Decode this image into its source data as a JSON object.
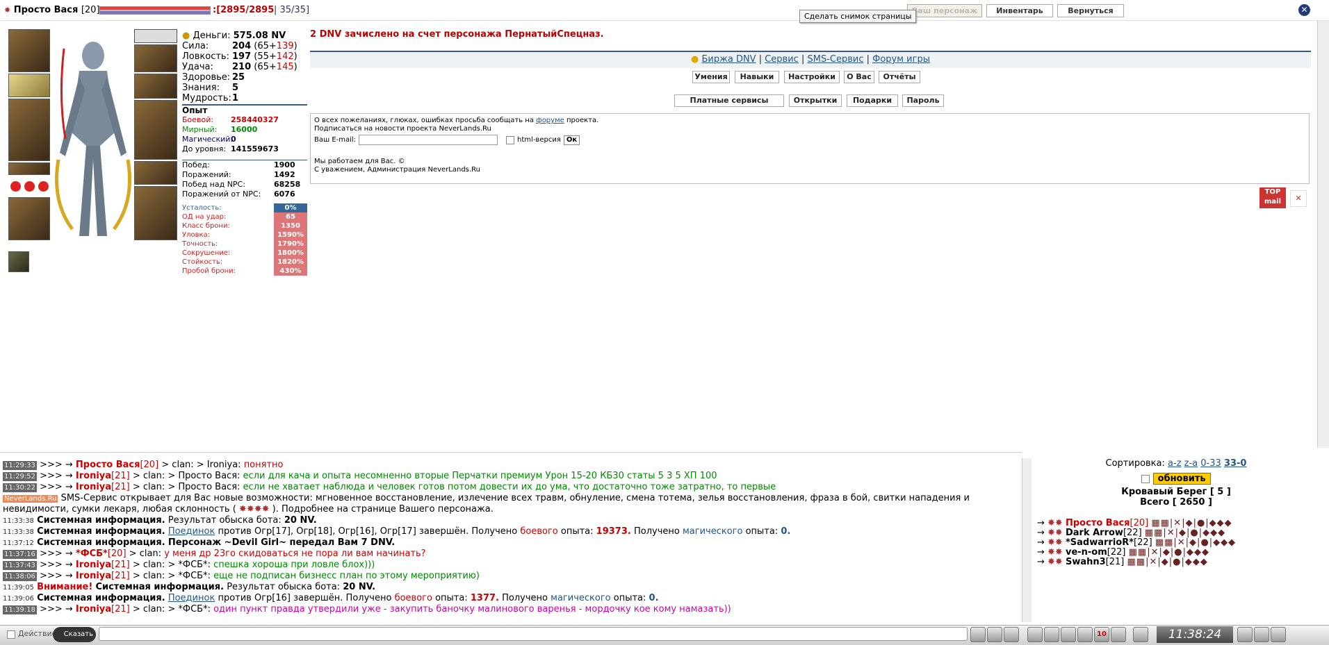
{
  "header": {
    "name": "Просто Вася",
    "level": "[20]",
    "hp": ":[2895/2895",
    "mp": "| 35/35]",
    "buttons": [
      "Ваш персонаж",
      "Инвентарь",
      "Вернуться"
    ],
    "tooltip": "Сделать снимок страницы"
  },
  "stats": {
    "money_label": "Деньги:",
    "money": "575.08 NV",
    "rows": [
      {
        "label": "Сила:",
        "value": "204",
        "extra": "(65+",
        "bonus": "139",
        "end": ")"
      },
      {
        "label": "Ловкость:",
        "value": "197",
        "extra": "(55+",
        "bonus": "142",
        "end": ")"
      },
      {
        "label": "Удача:",
        "value": "210",
        "extra": "(65+",
        "bonus": "145",
        "end": ")"
      },
      {
        "label": "Здоровье:",
        "value": "25",
        "extra": "",
        "bonus": "",
        "end": ""
      },
      {
        "label": "Знания:",
        "value": "5",
        "extra": "",
        "bonus": "",
        "end": ""
      },
      {
        "label": "Мудрость:",
        "value": "1",
        "extra": "",
        "bonus": "",
        "end": ""
      }
    ]
  },
  "experience": {
    "title": "Опыт",
    "combat_label": "Боевой:",
    "combat": "258440327",
    "peace_label": "Мирный:",
    "peace": "16000",
    "magic_label": "Магический:",
    "magic": "0",
    "next_label": "До уровня:",
    "next": "141559673"
  },
  "record": [
    {
      "label": "Побед:",
      "value": "1900"
    },
    {
      "label": "Поражений:",
      "value": "1492"
    },
    {
      "label": "Побед над NPC:",
      "value": "68258"
    },
    {
      "label": "Поражений от NPC:",
      "value": "6076"
    }
  ],
  "modifiers": [
    {
      "label": "Усталость:",
      "value": "0%"
    },
    {
      "label": "ОД на удар:",
      "value": "65"
    },
    {
      "label": "Класс брони:",
      "value": "1350"
    },
    {
      "label": "Уловка:",
      "value": "1590%"
    },
    {
      "label": "Точность:",
      "value": "1790%"
    },
    {
      "label": "Сокрушение:",
      "value": "1800%"
    },
    {
      "label": "Стойкость:",
      "value": "1820%"
    },
    {
      "label": "Пробой брони:",
      "value": "430%"
    }
  ],
  "notice": "2 DNV зачислено на счет персонажа ПернатыйСпецназ.",
  "links": [
    "Биржа DNV",
    "Сервис",
    "SMS-Сервис",
    "Форум игры"
  ],
  "nav1": [
    "Умения",
    "Навыки",
    "Настройки",
    "О Вас",
    "Отчёты"
  ],
  "nav2": [
    "Платные сервисы",
    "Открытки",
    "Подарки",
    "Пароль"
  ],
  "info": {
    "line1a": "О всех пожеланиях, глюках, ошибках просьба сообщать на",
    "line1link": "форуме",
    "line1b": "проекта.",
    "line2": "Подписаться на новости проекта NeverLands.Ru",
    "email_label": "Ваш E-mail:",
    "html_label": "html-версия",
    "ok": "Ок",
    "line3": "Мы работаем для Вас. ©",
    "line4": "С уважением, Администрация NeverLands.Ru"
  },
  "chat": {
    "lines": [
      {
        "time": "11:29:33",
        "name": "Просто Вася",
        "lvl": "[20]",
        "to": "> clan: > Ironiya:",
        "msg": "понятно",
        "cls": "msgr"
      },
      {
        "time": "11:29:52",
        "name": "Ironiya",
        "lvl": "[21]",
        "to": "> clan: > Просто Вася:",
        "msg": "если для кача и опыта несомненно вторые Перчатки премиум Урон 15-20 КБ30 статы 5 3 5 ХП 100",
        "cls": "msgg"
      },
      {
        "time": "11:30:22",
        "name": "Ironiya",
        "lvl": "[21]",
        "to": "> clan: > Просто Вася:",
        "msg": "если не хватает наблюда и человек готов потом довести их до ума, что достаточно тоже затратно, то первые",
        "cls": "msgg"
      }
    ],
    "sms_tag": "NeverLands.Ru",
    "sms1": "SMS-Сервис открывает для Вас новые возможности: мгновенное восстановление, излечение всех травм, обнуление, смена тотема, зелья восстановления, фраза в бой, свитки нападения и",
    "sms2": "невидимости, сумки лекаря, любая склонность (",
    "sms3": "). Подробнее на странице Вашего персонажа.",
    "sys": [
      {
        "time": "11:33:38",
        "bold": "Системная информация.",
        "text": "Результат обыска бота:",
        "val": "20 NV."
      },
      {
        "time": "11:33:38",
        "bold": "Системная информация.",
        "link": "Поединок",
        "text": "против Огр[17], Огр[18], Огр[16], Огр[17] завершён. Получено",
        "c": "боевого",
        "t2": "опыта:",
        "v1": "19373.",
        "t3": "Получено",
        "m": "магического",
        "t4": "опыта:",
        "v2": "0."
      },
      {
        "time": "11:37:12",
        "bold": "Системная информация.",
        "text": "Персонаж ~Devil Girl~ передал Вам 7 DNV."
      }
    ],
    "lines2": [
      {
        "time": "11:37:16",
        "name": "*ФСБ*",
        "lvl": "[20]",
        "to": "> clan:",
        "msg": "у меня др 23го скидоваться не пора ли вам начинать?",
        "cls": "msgr"
      },
      {
        "time": "11:37:43",
        "name": "Ironiya",
        "lvl": "[21]",
        "to": "> clan: > *ФСБ*:",
        "msg": "спешка хороша при ловле блох)))",
        "cls": "msgg"
      },
      {
        "time": "11:38:06",
        "name": "Ironiya",
        "lvl": "[21]",
        "to": "> clan: > *ФСБ*:",
        "msg": "еще не подписан бизнесс план по этому мероприятию)",
        "cls": "msgg"
      }
    ],
    "sys2_time": "11:39:05",
    "attn": "Внимание!",
    "sys2_bold": "Системная информация.",
    "sys2_text": "Результат обыска бота:",
    "sys2_val": "20 NV.",
    "sys3_time": "11:39:06",
    "sys3_text": "против Огр[16] завершён. Получено",
    "sys3_c": "боевого",
    "sys3_v1": "1377.",
    "sys3_m": "магического",
    "sys3_v2": "0.",
    "last": {
      "time": "11:39:18",
      "name": "Ironiya",
      "lvl": "[21]",
      "to": "> clan: > *ФСБ*:",
      "msg": "один пункт правда утвердили уже - закупить баночку малинового варенья - мордочку кое кому намазать))"
    }
  },
  "players": {
    "sort_label": "Сортировка:",
    "sorts": [
      "a-z",
      "z-a",
      "0-33",
      "33-0"
    ],
    "refresh": "обновить",
    "location": "Кровавый Берег [ 5 ]",
    "total": "Всего [ 2650 ]",
    "list": [
      {
        "name": "Просто Вася",
        "lvl": "[20]",
        "color": "#c00"
      },
      {
        "name": "Dark Arrow",
        "lvl": "[22]",
        "color": "#000"
      },
      {
        "name": "*SadwarrioR*",
        "lvl": "[22]",
        "color": "#000"
      },
      {
        "name": "ve-n-om",
        "lvl": "[22]",
        "color": "#000"
      },
      {
        "name": "Swahn3",
        "lvl": "[21]",
        "color": "#000"
      }
    ]
  },
  "bottom": {
    "action": "Действие",
    "say": "Сказать",
    "clock": "11:38:24",
    "counter": "10"
  }
}
